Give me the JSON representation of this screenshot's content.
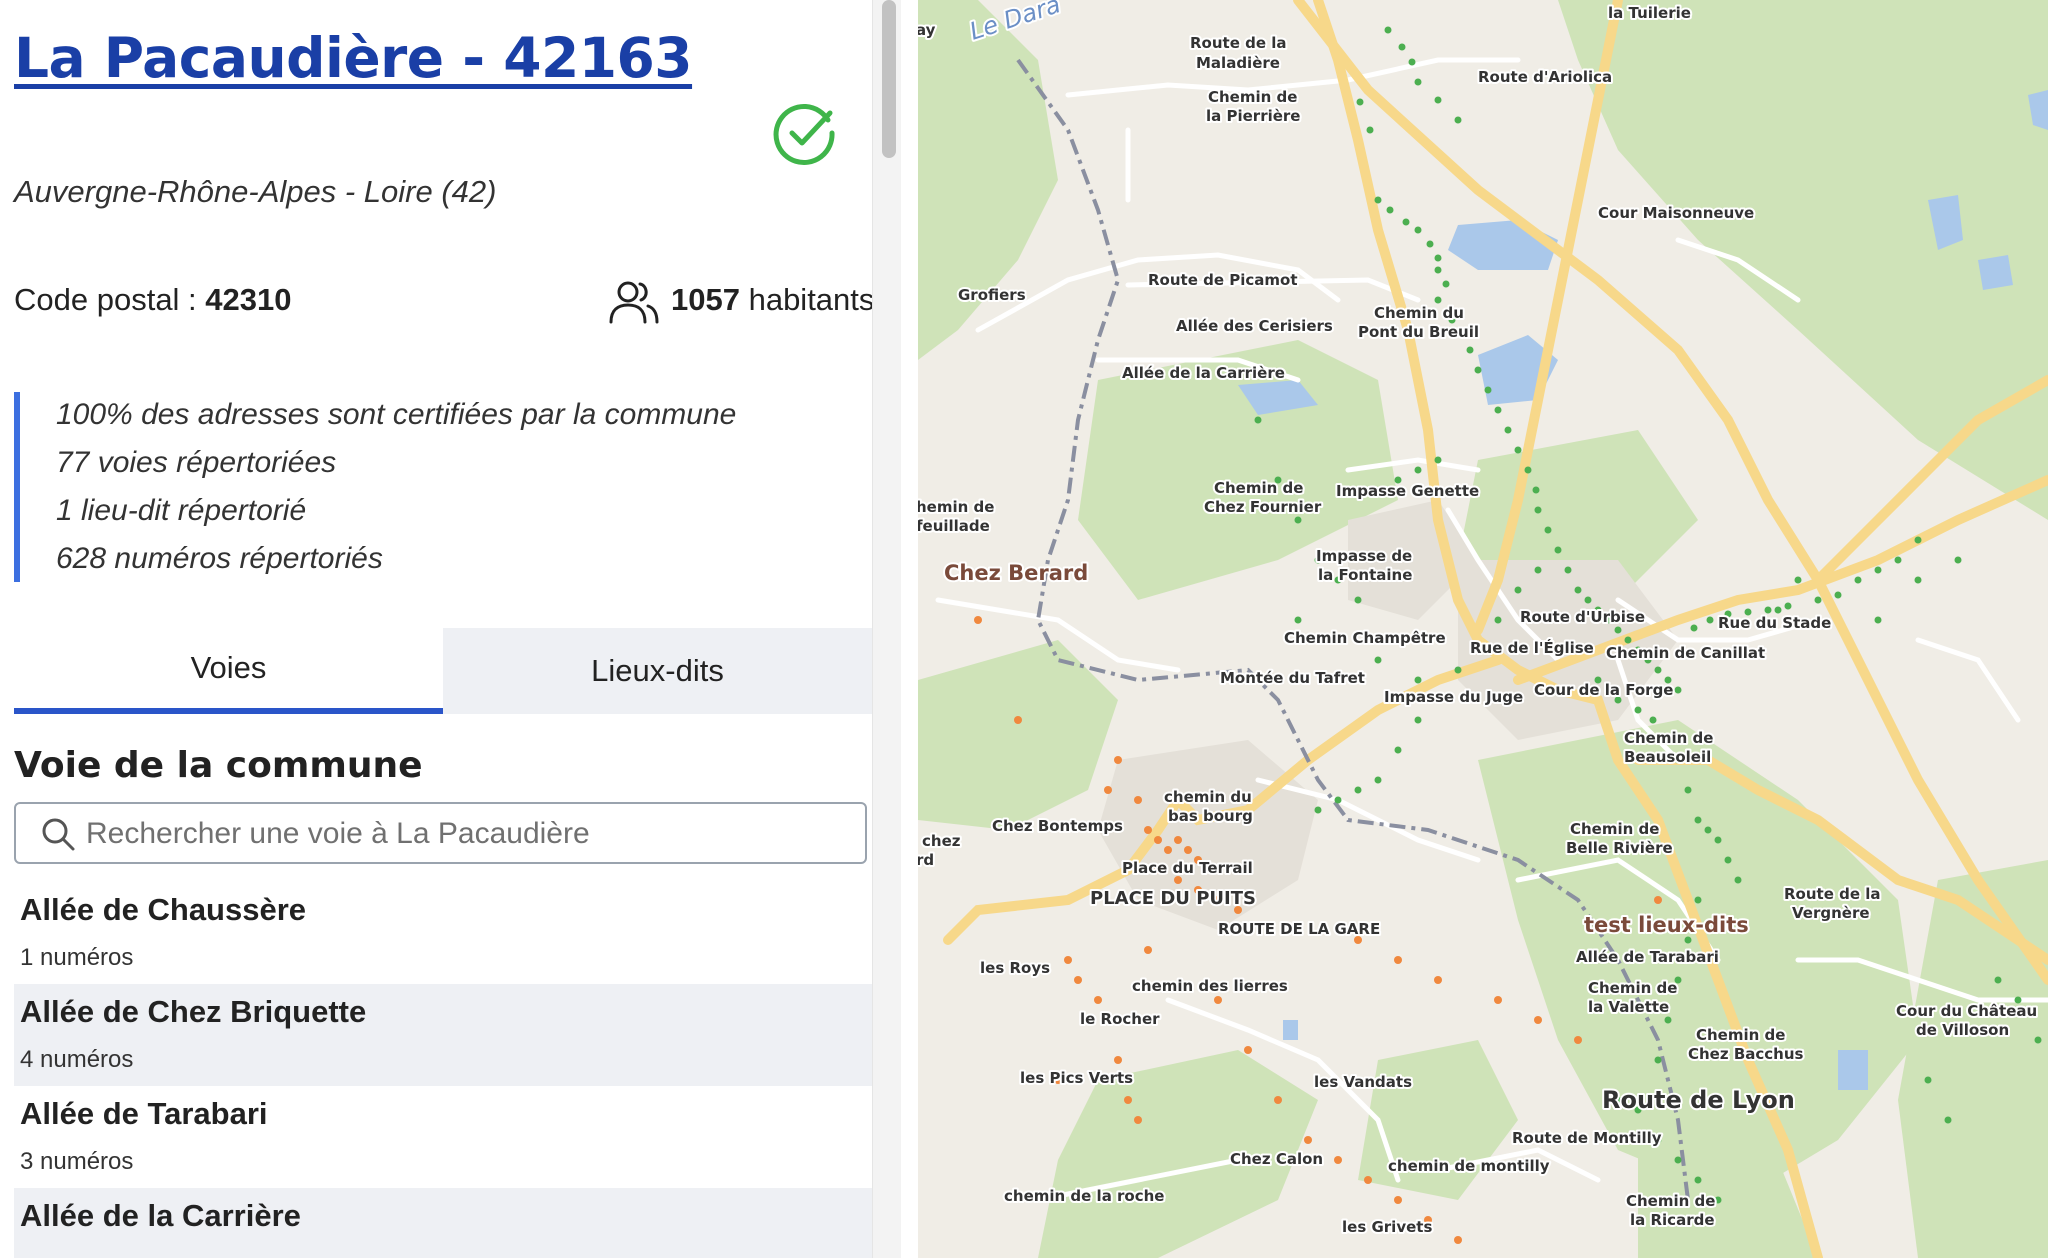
{
  "commune": {
    "title": "La Pacaudière - 42163",
    "region": "Auvergne-Rhône-Alpes - Loire (42)",
    "postal_label": "Code postal : ",
    "postal_code": "42310",
    "population_value": "1057",
    "population_label": " habitants",
    "status_icon": "check-circle-icon",
    "status_color": "#3fb54a"
  },
  "stats": [
    "100% des adresses sont certifiées par la commune",
    "77 voies répertoriées",
    "1 lieu-dit répertorié",
    "628 numéros répertoriés"
  ],
  "tabs": {
    "voies": "Voies",
    "lieux_dits": "Lieux-dits",
    "active": "voies"
  },
  "voies_section": {
    "title": "Voie de la commune",
    "search_placeholder": "Rechercher une voie à La Pacaudière"
  },
  "voies": [
    {
      "name": "Allée de Chaussère",
      "count": "1 numéros"
    },
    {
      "name": "Allée de Chez Briquette",
      "count": "4 numéros"
    },
    {
      "name": "Allée de Tarabari",
      "count": "3 numéros"
    },
    {
      "name": "Allée de la Carrière",
      "count": ""
    }
  ],
  "colors": {
    "accent": "#2a55c9",
    "title": "#1a3fa6",
    "certified_dot": "#4caf50",
    "uncertified_dot": "#f0883e",
    "road_major": "#f7d88a",
    "forest": "#cfe3b8"
  },
  "map": {
    "labels": {
      "la_tuilerie": "la Tuilerie",
      "route_maladiere_1": "Route de la",
      "route_maladiere_2": "Maladière",
      "route_ariolica": "Route d'Ariolica",
      "chemin_pierriere_1": "Chemin de",
      "chemin_pierriere_2": "la Pierrière",
      "le_dara": "Le Dara",
      "cour_maisonneuve": "Cour Maisonneuve",
      "grofiers": "Grofiers",
      "route_picamot": "Route de Picamot",
      "allee_cerisiers": "Allée des Cerisiers",
      "chemin_pont_breuil_1": "Chemin du",
      "chemin_pont_breuil_2": "Pont du Breuil",
      "allee_carriere": "Allée de la Carrière",
      "chemin_chez_fournier_1": "Chemin de",
      "chemin_chez_fournier_2": "Chez Fournier",
      "impasse_genette": "Impasse Genette",
      "chemin_feuillade_1": "hemin de",
      "chemin_feuillade_2": "feuillade",
      "impasse_fontaine_1": "Impasse de",
      "impasse_fontaine_2": "la Fontaine",
      "chez_berard": "Chez Berard",
      "route_urbise": "Route d'Urbise",
      "rue_stade": "Rue du Stade",
      "chemin_champetre": "Chemin Champêtre",
      "rue_eglise": "Rue de l'Église",
      "chemin_canillat": "Chemin de Canillat",
      "montee_tafret": "Montée du Tafret",
      "cour_forge": "Cour de la Forge",
      "impasse_juge": "Impasse du Juge",
      "chemin_beausoleil_1": "Chemin de",
      "chemin_beausoleil_2": "Beausoleil",
      "chemin_bas_bourg_1": "chemin du",
      "chemin_bas_bourg_2": "bas bourg",
      "chez_bontemps": "Chez Bontemps",
      "chez_left_1": "chez",
      "chez_left_2": "rd",
      "chemin_belle_riviere_1": "Chemin de",
      "chemin_belle_riviere_2": "Belle Rivière",
      "place_terrail": "Place du Terrail",
      "route_vergnere_1": "Route de la",
      "route_vergnere_2": "Vergnère",
      "place_puits": "PLACE DU PUITS",
      "route_gare": "ROUTE DE LA GARE",
      "test_lieux_dits": "test lieux-dits",
      "allee_tarabari": "Allée de Tarabari",
      "les_roys": "les Roys",
      "chemin_lierres": "chemin des lierres",
      "chemin_valette_1": "Chemin de",
      "chemin_valette_2": "la Valette",
      "cour_chateau_1": "Cour du Château",
      "cour_chateau_2": "de Villoson",
      "le_rocher": "le Rocher",
      "chemin_bacchus_1": "Chemin de",
      "chemin_bacchus_2": "Chez Bacchus",
      "les_pics_verts": "les Pics Verts",
      "les_vandats": "les Vandats",
      "route_lyon": "Route de Lyon",
      "route_montilly": "Route de Montilly",
      "chez_calon": "Chez Calon",
      "chemin_montilly": "chemin de montilly",
      "chemin_roche": "chemin de la roche",
      "chemin_ricarde_1": "Chemin de",
      "chemin_ricarde_2": "la Ricarde",
      "les_grivets": "les Grivets",
      "ay": "ay"
    }
  }
}
